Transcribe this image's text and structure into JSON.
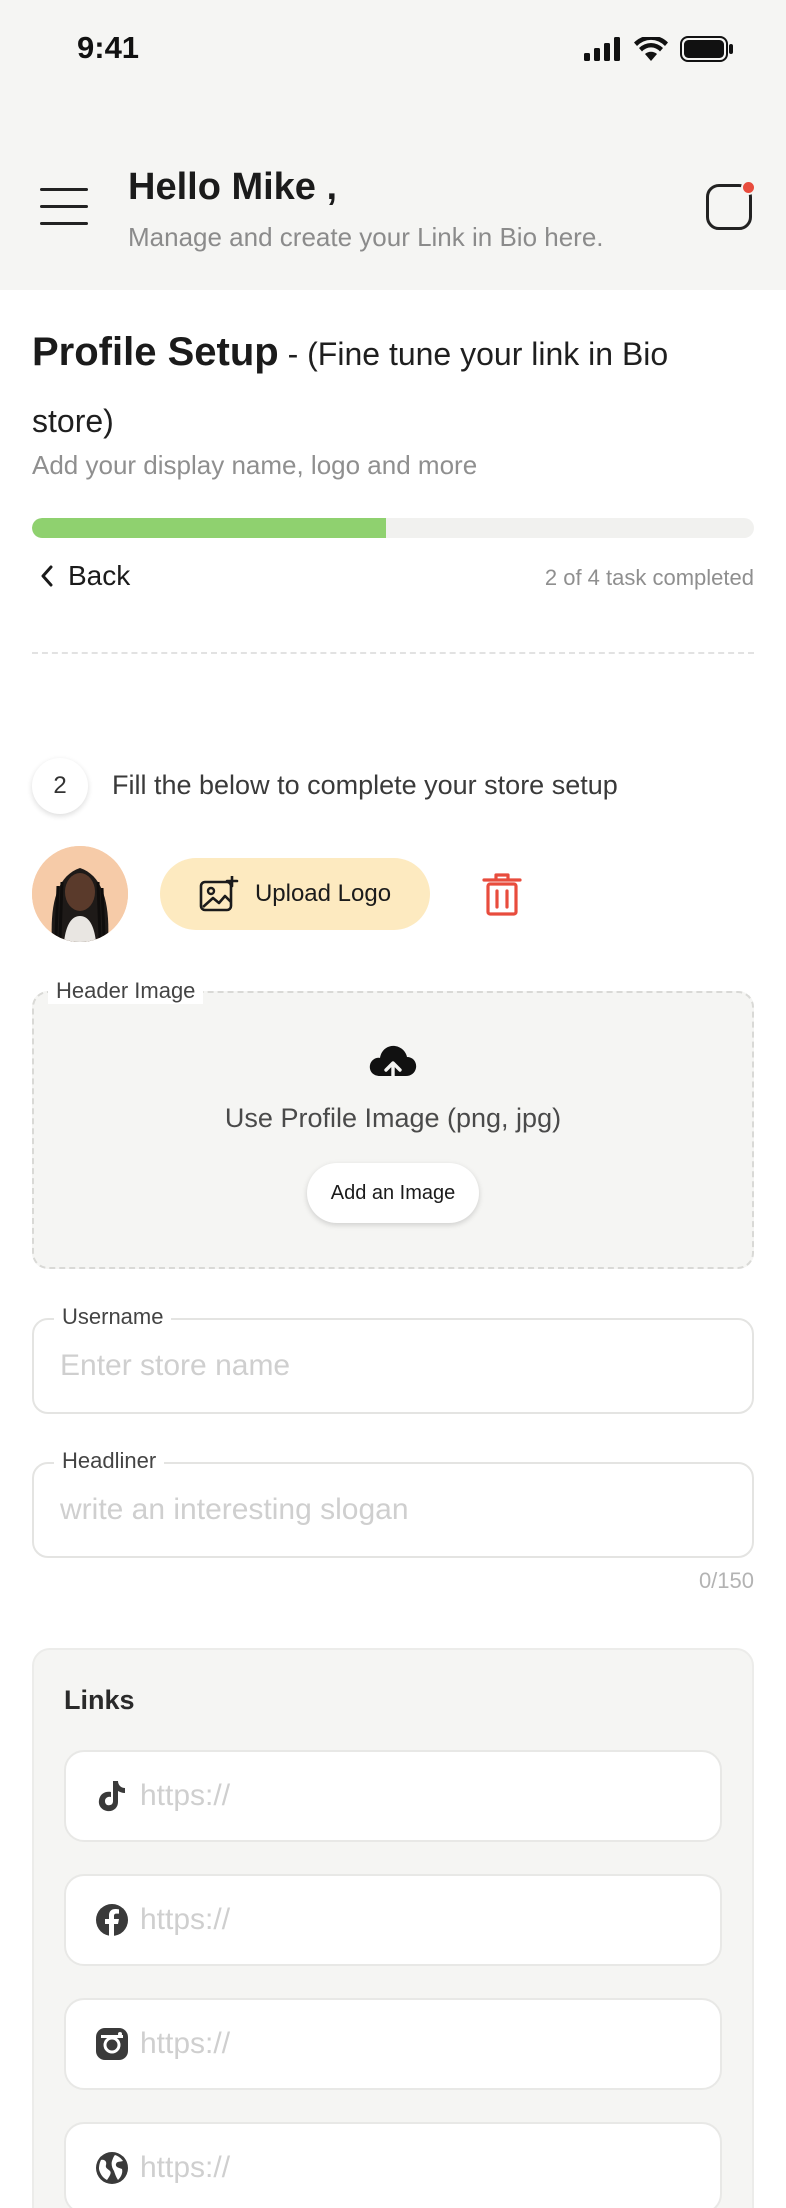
{
  "status_bar": {
    "time": "9:41"
  },
  "header": {
    "greeting": "Hello Mike ,",
    "subtitle": "Manage and create your Link in Bio here."
  },
  "setup": {
    "title": "Profile Setup",
    "title_suffix": " - (Fine tune your link in Bio store)",
    "subtitle": "Add your display name, logo and more",
    "progress_fraction": 0.49,
    "back_label": "Back",
    "task_status": "2 of 4 task completed"
  },
  "step": {
    "number": "2",
    "text": "Fill the below to complete your store setup"
  },
  "logo": {
    "upload_label": "Upload Logo"
  },
  "header_image": {
    "legend": "Header Image",
    "hint": "Use Profile Image (png, jpg)",
    "button_label": "Add an Image"
  },
  "username": {
    "legend": "Username",
    "placeholder": "Enter store name"
  },
  "headliner": {
    "legend": "Headliner",
    "placeholder": "write an interesting slogan",
    "counter": "0/150"
  },
  "links": {
    "title": "Links",
    "items": [
      {
        "icon": "tiktok-icon",
        "placeholder": "https://"
      },
      {
        "icon": "facebook-icon",
        "placeholder": "https://"
      },
      {
        "icon": "instagram-icon",
        "placeholder": "https://"
      },
      {
        "icon": "globe-icon",
        "placeholder": "https://"
      }
    ]
  },
  "colors": {
    "progress": "#8fd16f",
    "upload_button": "#fdeac0",
    "danger": "#e84c3d",
    "notification_dot": "#e84c3d"
  }
}
